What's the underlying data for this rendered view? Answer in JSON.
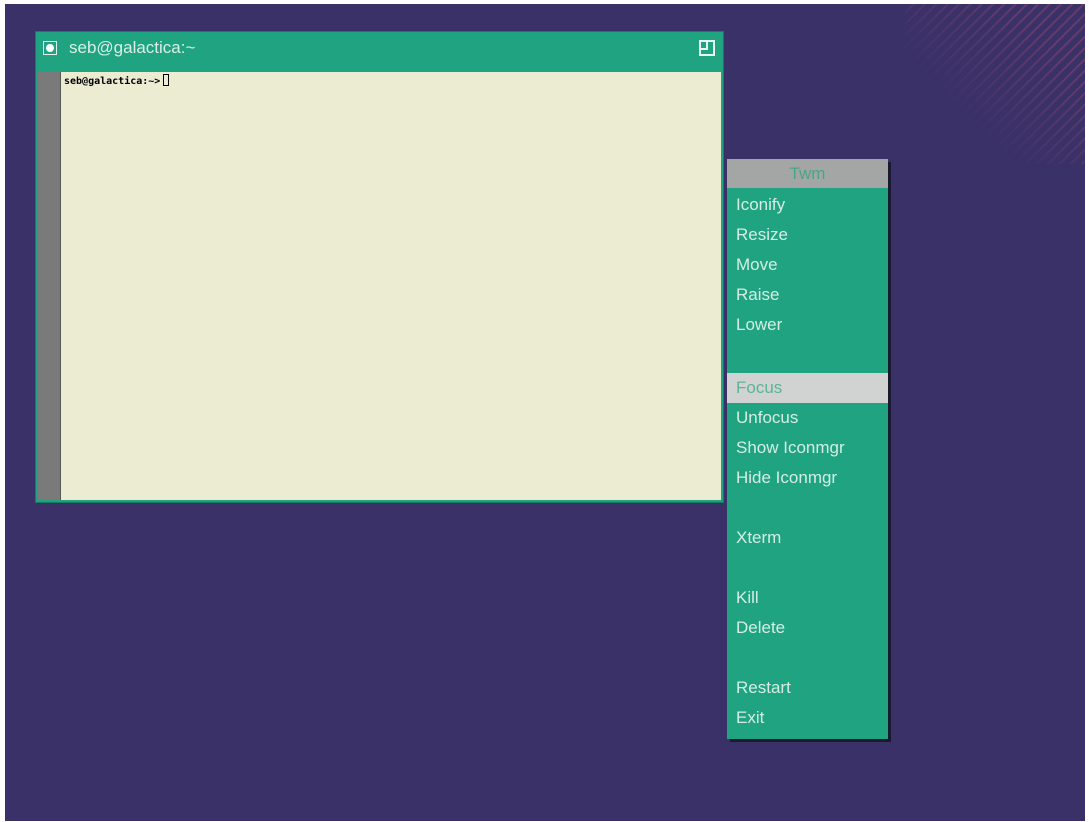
{
  "terminal": {
    "title": "seb@galactica:~",
    "prompt": "seb@galactica:~>"
  },
  "menu": {
    "title": "Twm",
    "items": [
      {
        "label": "Iconify"
      },
      {
        "label": "Resize"
      },
      {
        "label": "Move"
      },
      {
        "label": "Raise"
      },
      {
        "label": "Lower"
      },
      {
        "label": ""
      },
      {
        "label": "Focus",
        "selected": true
      },
      {
        "label": "Unfocus"
      },
      {
        "label": "Show Iconmgr"
      },
      {
        "label": "Hide Iconmgr"
      },
      {
        "label": ""
      },
      {
        "label": "Xterm"
      },
      {
        "label": ""
      },
      {
        "label": "Kill"
      },
      {
        "label": "Delete"
      },
      {
        "label": ""
      },
      {
        "label": "Restart"
      },
      {
        "label": "Exit"
      }
    ]
  },
  "colors": {
    "desktop": "#3b3169",
    "accent": "#1fa381",
    "terminal_bg": "#ececd3",
    "menu_title_bg": "#a4a6a5",
    "selected_bg": "#d1d3d2"
  },
  "icons": {
    "window_menu": "window-menu-icon",
    "resize": "resize-icon"
  }
}
